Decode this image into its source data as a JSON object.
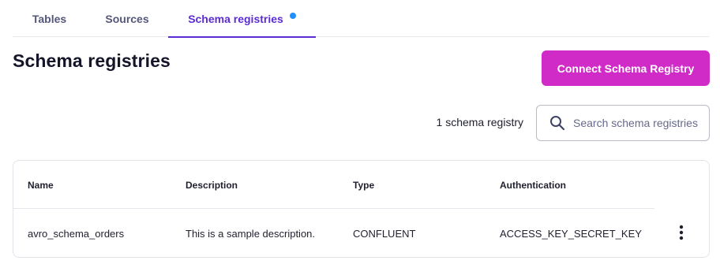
{
  "tabs": [
    {
      "label": "Tables",
      "active": false
    },
    {
      "label": "Sources",
      "active": false
    },
    {
      "label": "Schema registries",
      "active": true,
      "indicator_color": "#1e90ff"
    }
  ],
  "page": {
    "title": "Schema registries"
  },
  "actions": {
    "connect_label": "Connect Schema Registry"
  },
  "summary": {
    "count_text": "1 schema registry"
  },
  "search": {
    "placeholder": "Search schema registries",
    "value": ""
  },
  "table": {
    "columns": [
      "Name",
      "Description",
      "Type",
      "Authentication"
    ],
    "rows": [
      [
        "avro_schema_orders",
        "This is a sample description.",
        "CONFLUENT",
        "ACCESS_KEY_SECRET_KEY"
      ]
    ]
  },
  "colors": {
    "accent": "#5b2bd6",
    "primary_button": "#d12bc7",
    "tab_inactive": "#55577a"
  },
  "icons": {
    "search": "search-icon",
    "row_menu": "more-vertical-icon"
  }
}
